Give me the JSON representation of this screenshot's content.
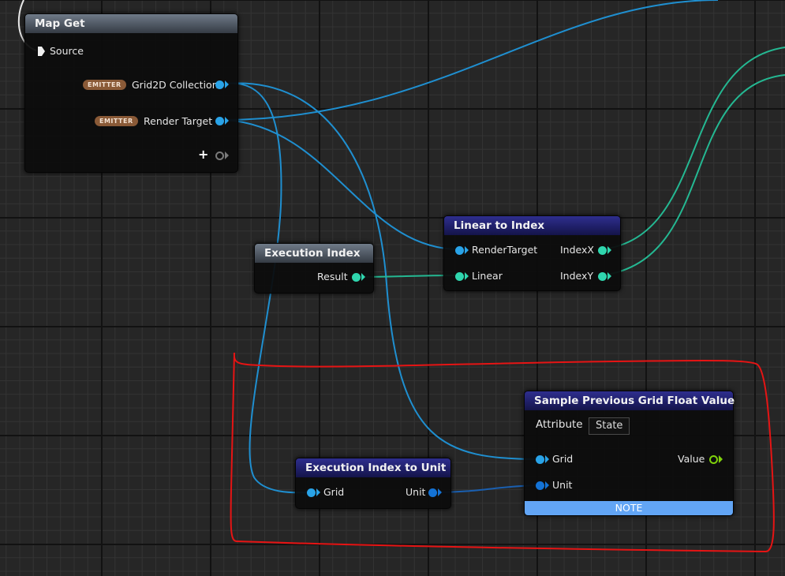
{
  "nodes": {
    "map_get": {
      "title": "Map Get",
      "source_label": "Source",
      "grid_badge": "EMITTER",
      "grid_label": "Grid2D Collection",
      "rt_badge": "EMITTER",
      "rt_label": "Render Target",
      "add_pin_icon": "plus-icon"
    },
    "execution_index": {
      "title": "Execution Index",
      "result_label": "Result"
    },
    "linear_to_index": {
      "title": "Linear to Index",
      "rendertarget_label": "RenderTarget",
      "linear_label": "Linear",
      "indexx_label": "IndexX",
      "indexy_label": "IndexY"
    },
    "execution_index_to_unit": {
      "title": "Execution Index to Unit",
      "grid_label": "Grid",
      "unit_label": "Unit"
    },
    "sample_previous": {
      "title": "Sample Previous Grid Float Value",
      "attribute_label": "Attribute",
      "attribute_value": "State",
      "grid_label": "Grid",
      "unit_label": "Unit",
      "value_label": "Value",
      "note_label": "NOTE"
    }
  },
  "colors": {
    "wire_object": "#1f8fd0",
    "wire_int": "#24b892",
    "wire_vector": "#1a5fb0",
    "annotation_outline": "#e61414",
    "header_gray": "#4f5762",
    "header_navy": "#22227a",
    "note_bar": "#62a5f5"
  }
}
